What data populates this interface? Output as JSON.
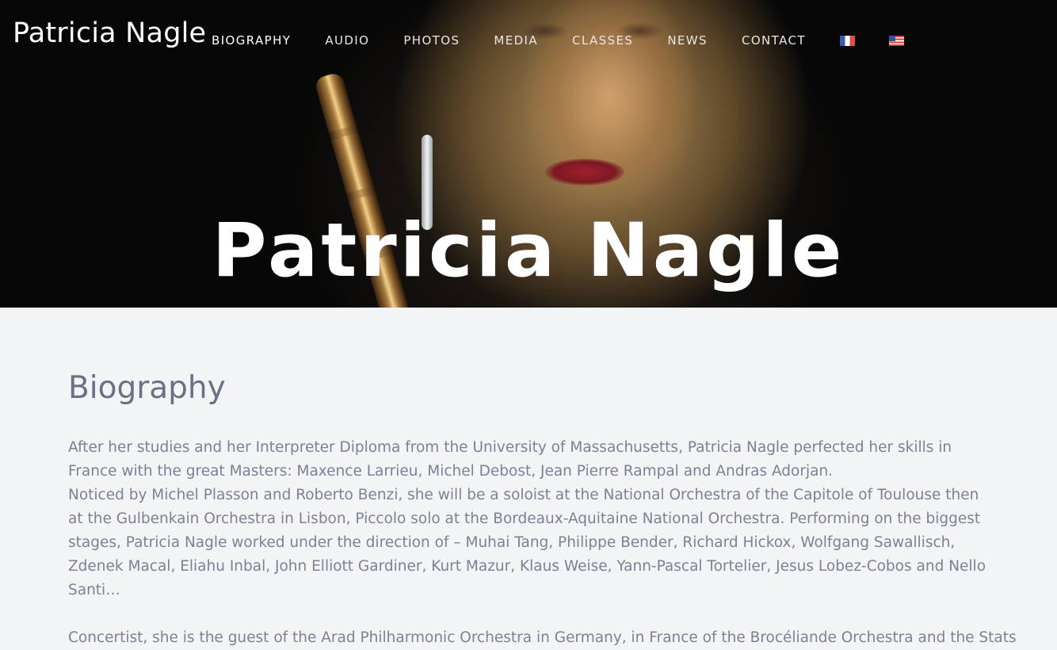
{
  "header": {
    "site_title": "Patricia Nagle",
    "nav": [
      {
        "label": "BIOGRAPHY"
      },
      {
        "label": "AUDIO"
      },
      {
        "label": "PHOTOS"
      },
      {
        "label": "MEDIA"
      },
      {
        "label": "CLASSES"
      },
      {
        "label": "NEWS"
      },
      {
        "label": "CONTACT"
      }
    ],
    "languages": [
      {
        "icon": "french-flag-icon"
      },
      {
        "icon": "us-flag-icon"
      }
    ]
  },
  "hero": {
    "title": "Patricia Nagle"
  },
  "main": {
    "heading": "Biography",
    "paragraph_1_line_1": "After her studies and her Interpreter Diploma from the University of Massachusetts, Patricia Nagle perfected her skills in France with the great Masters: Maxence Larrieu, Michel Debost, Jean Pierre Rampal and Andras Adorjan.",
    "paragraph_1_line_2": "Noticed by Michel Plasson and Roberto Benzi, she will be a soloist at the National Orchestra of the Capitole of Toulouse then at the Gulbenkain Orchestra in Lisbon, Piccolo solo at the Bordeaux-Aquitaine National Orchestra. Performing on the biggest stages, Patricia Nagle worked under the direction of – Muhai Tang, Philippe Bender, Richard Hickox, Wolfgang Sawallisch, Zdenek Macal, Eliahu Inbal, John Elliott Gardiner, Kurt Mazur, Klaus Weise, Yann-Pascal Tortelier, Jesus Lobez-Cobos and Nello Santi…",
    "paragraph_2": "Concertist, she is the guest of the Arad Philharmonic Orchestra in Germany, in France of the Brocéliande Orchestra and the Stats"
  }
}
